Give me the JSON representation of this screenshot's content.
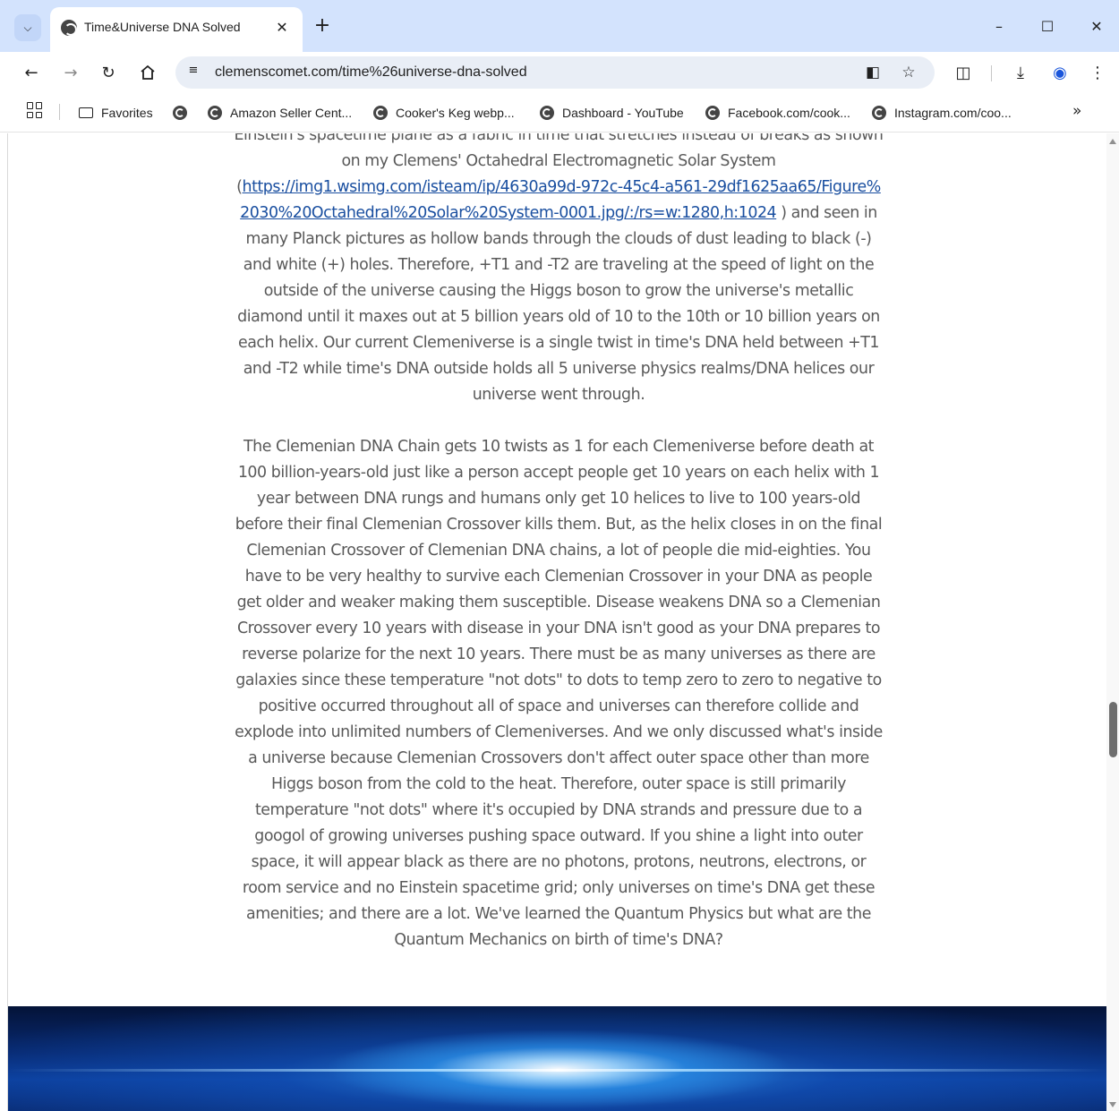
{
  "browser": {
    "tab": {
      "title": "Time&Universe DNA Solved",
      "close_glyph": "✕"
    },
    "new_tab_glyph": "+",
    "window_controls": {
      "minimize": "–",
      "maximize": "☐",
      "close": "✕"
    },
    "omnibox": {
      "url": "clemenscomet.com/time%26universe-dna-solved"
    },
    "icons": {
      "tab_search": "chevron-down-icon",
      "back": "back-arrow-icon",
      "forward": "forward-arrow-icon",
      "reload": "reload-icon",
      "home": "home-icon",
      "site_info": "tune-icon",
      "cast": "cast-icon",
      "bookmark": "star-icon",
      "extensions": "puzzle-icon",
      "downloads": "download-icon",
      "profile": "profile-icon",
      "menu": "kebab-menu-icon"
    }
  },
  "bookmarks": {
    "items": [
      {
        "label": "Favorites"
      },
      {
        "label": ""
      },
      {
        "label": "Amazon Seller Cent..."
      },
      {
        "label": "Cooker's Keg webp..."
      },
      {
        "label": "Dashboard - YouTube"
      },
      {
        "label": "Facebook.com/cook..."
      },
      {
        "label": "Instagram.com/coo..."
      }
    ],
    "more_glyph": "»"
  },
  "article": {
    "p1_partial_top": "Einstein's spacetime plane as a fabric in time that stretches instead of breaks as shown on",
    "p1_line2": "my Clemens' Octahedral Electromagnetic Solar System",
    "p1_link_open": "(",
    "p1_link": "https://img1.wsimg.com/isteam/ip/4630a99d-972c-45c4-a561-29df1625aa65/Figure%2030%20Octahedral%20Solar%20System-0001.jpg/:/rs=w:1280,h:1024",
    "p1_rest": " ) and seen in many Planck pictures as hollow bands through the clouds of dust leading to black (-) and white (+) holes. Therefore, +T1 and -T2 are traveling at the speed of light on the outside of the universe causing the Higgs boson to grow the universe's metallic diamond until it maxes out at 5 billion years old of 10 to the 10th or 10 billion years on each helix. Our current Clemeniverse is a single twist in time's DNA held between +T1 and -T2 while time's DNA outside holds all 5 universe physics realms/DNA helices our universe went through.",
    "p2": "The Clemenian DNA Chain gets 10 twists as 1 for each Clemeniverse before death at 100 billion-years-old just like a person accept people get 10 years on each helix with 1 year between DNA rungs and humans only get 10 helices to live to 100 years-old before their final Clemenian Crossover kills them. But, as the helix closes in on the final Clemenian Crossover of Clemenian DNA chains, a lot of people die mid-eighties. You have to be very healthy to survive each Clemenian Crossover in your DNA as people get older and weaker making them susceptible. Disease weakens DNA so a Clemenian Crossover every 10 years with disease in your DNA isn't good as your DNA prepares to reverse polarize for the next 10 years. There must be as many universes as there are galaxies since these temperature \"not dots\" to dots to temp zero to zero to negative to positive occurred throughout all of space and universes can therefore collide and explode into unlimited numbers of Clemeniverses. And we only discussed what's inside a universe because Clemenian Crossovers don't affect outer space other than more Higgs boson from the cold to the heat. Therefore, outer space is still primarily temperature \"not dots\" where it's occupied by DNA strands and pressure due to a googol of growing universes pushing space outward. If you shine a light into outer space, it will appear black as there are no photons, protons, neutrons, electrons, or room service and no Einstein spacetime grid; only universes on time's DNA get these amenities; and there are a lot. We've learned the Quantum Physics but what are the Quantum Mechanics on birth of time's DNA?"
  },
  "scrollbar": {
    "position_fraction": 0.62
  },
  "colors": {
    "tabstrip": "#d3e3fd",
    "omnibox": "#e9eef6",
    "body_text": "#595959",
    "link": "#1a4fa0"
  }
}
